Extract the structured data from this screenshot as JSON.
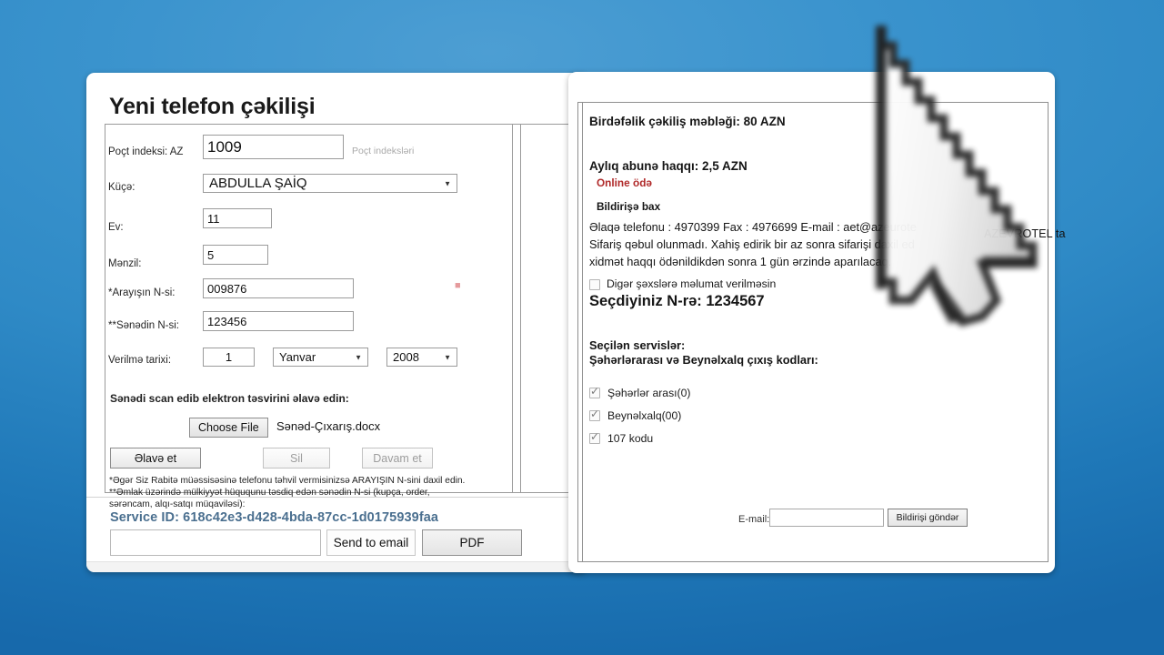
{
  "background": {
    "color_top": "#4d9ed3",
    "color_bottom": "#1769ab"
  },
  "left_panel": {
    "title": "Yeni telefon çəkilişi",
    "fields": [
      {
        "label": "Poçt indeksi: AZ",
        "value": "1009",
        "hint": "Poçt indeksləri",
        "type": "text"
      },
      {
        "label": "Küçə:",
        "value": "ABDULLA ŞAİQ",
        "type": "select"
      },
      {
        "label": "Ev:",
        "value": "11",
        "type": "text"
      },
      {
        "label": "Mənzil:",
        "value": "5",
        "type": "text"
      },
      {
        "label": "*Arayışın N-si:",
        "value": "009876",
        "type": "text"
      },
      {
        "label": "**Sənədin N-si:",
        "value": "123456",
        "type": "text"
      }
    ],
    "date_row": {
      "label": "Verilmə tarixi:",
      "day": "1",
      "month": "Yanvar",
      "year": "2008"
    },
    "upload_caption": "Sənədi scan edib elektron təsvirini əlavə edin:",
    "file_button": "Choose File",
    "file_name": "Sənəd-Çıxarış.docx",
    "buttons": {
      "add": "Əlavə et",
      "delete": "Sil",
      "continue": "Davam et"
    },
    "footnotes": [
      "*Əgər Siz Rabitə müəssisəsinə telefonu təhvil vermisinizsə ARAYIŞIN N-sini daxil edin.",
      "**Əmlak üzərində mülkiyyət hüququnu təsdiq edən sənədin N-si (kupça, order,",
      "sərəncam, alqı-satqı müqaviləsi):"
    ],
    "service_id": "Service ID: 618c42e3-d428-4bda-87cc-1d0175939faa",
    "service_input_value": "",
    "send_email_button": "Send to email",
    "pdf_button": "PDF"
  },
  "right_panel": {
    "one_time_fee": "Birdəfəlik çəkiliş məbləği: 80 AZN",
    "monthly_fee": "Aylıq abunə haqqı: 2,5 AZN",
    "online_pay_link": "Online ödə",
    "view_notice_link": "Bildirişə bax",
    "contact_line": "Əlaqə telefonu : 4970399 Fax : 4976699 E-mail : aet@azeurote",
    "order_line": "Sifariş qəbul olunmadı. Xahiş edirik bir az sonra sifarişi daxil ed",
    "service_line": "xidmət haqqı ödənildikdən sonra 1 gün ərzində aparılacaq.",
    "privacy_checkbox": {
      "label": "Digər şəxslərə məlumat verilməsin",
      "checked": false
    },
    "selected_number": "Seçdiyiniz N-rə: 1234567",
    "selected_services_heading": "Seçilən servislər:",
    "codes_heading": "Şəhərlərarası və Beynəlxalq çıxış kodları:",
    "service_checkboxes": [
      {
        "label": "Şəhərlər arası(0)",
        "checked": true
      },
      {
        "label": "Beynəlxalq(00)",
        "checked": true
      },
      {
        "label": "107 kodu",
        "checked": true
      }
    ],
    "email_label": "E-mail:",
    "email_value": "",
    "notify_button": "Bildirişi göndər",
    "overlay_text": "AZEVROTEL ta"
  },
  "cursor": {
    "icon": "mouse-pointer-arrow"
  }
}
